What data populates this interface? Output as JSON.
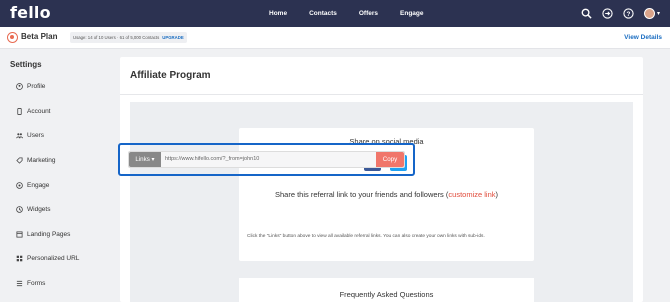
{
  "brand": {
    "logo": "fello"
  },
  "nav": {
    "links": [
      "Home",
      "Contacts",
      "Offers",
      "Engage"
    ],
    "icons": [
      "search-icon",
      "login-icon",
      "help-icon",
      "avatar"
    ]
  },
  "planbar": {
    "title": "Beta Plan",
    "usage": "Usage: 14 of 10 Users · 61 of 5,000 Contacts",
    "upgrade": "UPGRADE",
    "view_details": "View Details"
  },
  "sidebar": {
    "title": "Settings",
    "items": [
      {
        "label": "Profile",
        "icon": "profile-icon"
      },
      {
        "label": "Account",
        "icon": "account-icon"
      },
      {
        "label": "Users",
        "icon": "users-icon"
      },
      {
        "label": "Marketing",
        "icon": "marketing-icon"
      },
      {
        "label": "Engage",
        "icon": "engage-icon"
      },
      {
        "label": "Widgets",
        "icon": "widgets-icon"
      },
      {
        "label": "Landing Pages",
        "icon": "landing-pages-icon"
      },
      {
        "label": "Personalized URL",
        "icon": "url-icon"
      },
      {
        "label": "Forms",
        "icon": "forms-icon"
      }
    ]
  },
  "main": {
    "title": "Affiliate Program",
    "share_social": "Share on social media",
    "share_ref_prefix": "Share this referral link to your friends and followers (",
    "customize_link": "customize link",
    "share_ref_suffix": ")",
    "links_button": "Links",
    "referral_url": "https://www.hifello.com/?_from=john10",
    "copy_button": "Copy",
    "help_text": "Click the \"Links\" button above to view all available referral links. You can also create your own links with sub-ids.",
    "faq_title": "Frequently Asked Questions"
  },
  "colors": {
    "nav_bg": "#2c3251",
    "accent": "#1b6ec2",
    "copy": "#f0766a",
    "customize": "#e04b3b",
    "highlight": "#1565c8"
  }
}
